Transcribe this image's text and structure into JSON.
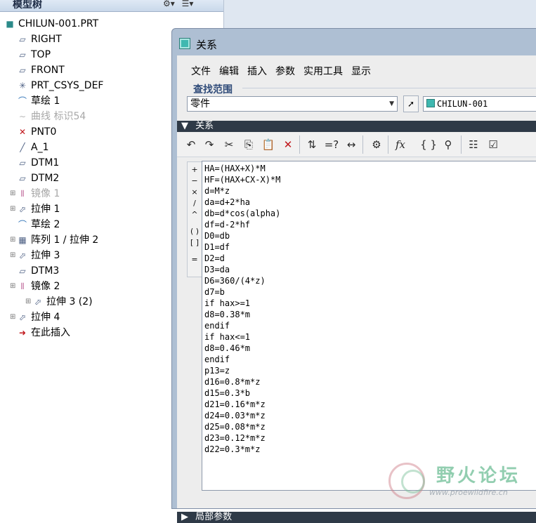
{
  "model_tree": {
    "title": "模型树",
    "tools": [
      "tree-filter-icon",
      "tree-columns-icon"
    ],
    "items": [
      {
        "label": "CHILUN-001.PRT",
        "icon": "part-icon",
        "expander": false,
        "state": "normal"
      },
      {
        "label": "RIGHT",
        "icon": "datum-plane-icon",
        "expander": false,
        "state": "normal"
      },
      {
        "label": "TOP",
        "icon": "datum-plane-icon",
        "expander": false,
        "state": "normal"
      },
      {
        "label": "FRONT",
        "icon": "datum-plane-icon",
        "expander": false,
        "state": "normal"
      },
      {
        "label": "PRT_CSYS_DEF",
        "icon": "csys-icon",
        "expander": false,
        "state": "normal"
      },
      {
        "label": "草绘 1",
        "icon": "sketch-icon",
        "expander": false,
        "state": "normal"
      },
      {
        "label": "曲线 标识54",
        "icon": "curve-icon",
        "expander": false,
        "state": "dim"
      },
      {
        "label": "PNT0",
        "icon": "datum-point-icon",
        "expander": false,
        "state": "normal"
      },
      {
        "label": "A_1",
        "icon": "datum-axis-icon",
        "expander": false,
        "state": "normal"
      },
      {
        "label": "DTM1",
        "icon": "datum-plane-icon",
        "expander": false,
        "state": "normal"
      },
      {
        "label": "DTM2",
        "icon": "datum-plane-icon",
        "expander": false,
        "state": "normal"
      },
      {
        "label": "镜像 1",
        "icon": "mirror-icon",
        "expander": true,
        "state": "dim"
      },
      {
        "label": "拉伸 1",
        "icon": "extrude-icon",
        "expander": true,
        "state": "normal"
      },
      {
        "label": "草绘 2",
        "icon": "sketch-icon",
        "expander": false,
        "state": "normal"
      },
      {
        "label": "阵列 1 / 拉伸 2",
        "icon": "pattern-icon",
        "expander": true,
        "state": "normal"
      },
      {
        "label": "拉伸 3",
        "icon": "extrude-icon",
        "expander": true,
        "state": "normal"
      },
      {
        "label": "DTM3",
        "icon": "datum-plane-icon",
        "expander": false,
        "state": "normal"
      },
      {
        "label": "镜像 2",
        "icon": "mirror-icon",
        "expander": true,
        "state": "normal"
      },
      {
        "label": "拉伸 3 (2)",
        "icon": "extrude-icon",
        "expander": true,
        "state": "normal",
        "indent": true
      },
      {
        "label": "拉伸 4",
        "icon": "extrude-icon",
        "expander": true,
        "state": "normal"
      },
      {
        "label": "在此插入",
        "icon": "insert-here-icon",
        "expander": false,
        "state": "normal"
      }
    ]
  },
  "dialog": {
    "title": "关系",
    "menu": [
      "文件",
      "编辑",
      "插入",
      "参数",
      "实用工具",
      "显示"
    ],
    "scope_label": "查找范围",
    "scope_value": "零件",
    "model_value": "CHILUN-001",
    "relations_label": "关系",
    "toolbar_icons": [
      "undo-icon",
      "redo-icon",
      "cut-icon",
      "copy-icon",
      "paste-icon",
      "delete-icon",
      "units-icon",
      "verify-icon",
      "dimension-icon",
      "sort-icon",
      "function-icon",
      "brackets-icon",
      "evaluate-icon",
      "list-icon",
      "check-icon"
    ],
    "operators": [
      "+",
      "−",
      "×",
      "/",
      "^",
      "( )",
      "[ ]",
      "="
    ],
    "relations": [
      "HA=(HAX+X)*M",
      "HF=(HAX+CX-X)*M",
      "d=M*z",
      "da=d+2*ha",
      "db=d*cos(alpha)",
      "df=d-2*hf",
      "D0=db",
      "D1=df",
      "D2=d",
      "D3=da",
      "D6=360/(4*z)",
      "d7=b",
      "if hax>=1",
      "d8=0.38*m",
      "endif",
      "if hax<=1",
      "d8=0.46*m",
      "endif",
      "p13=z",
      "d16=0.8*m*z",
      "d15=0.3*b",
      "d21=0.16*m*z",
      "d24=0.03*m*z",
      "d25=0.08*m*z",
      "d23=0.12*m*z",
      "d22=0.3*m*z"
    ],
    "local_params_label": "局部参数"
  },
  "watermark": {
    "text": "野火论坛",
    "url": "www.proewildfire.cn"
  }
}
